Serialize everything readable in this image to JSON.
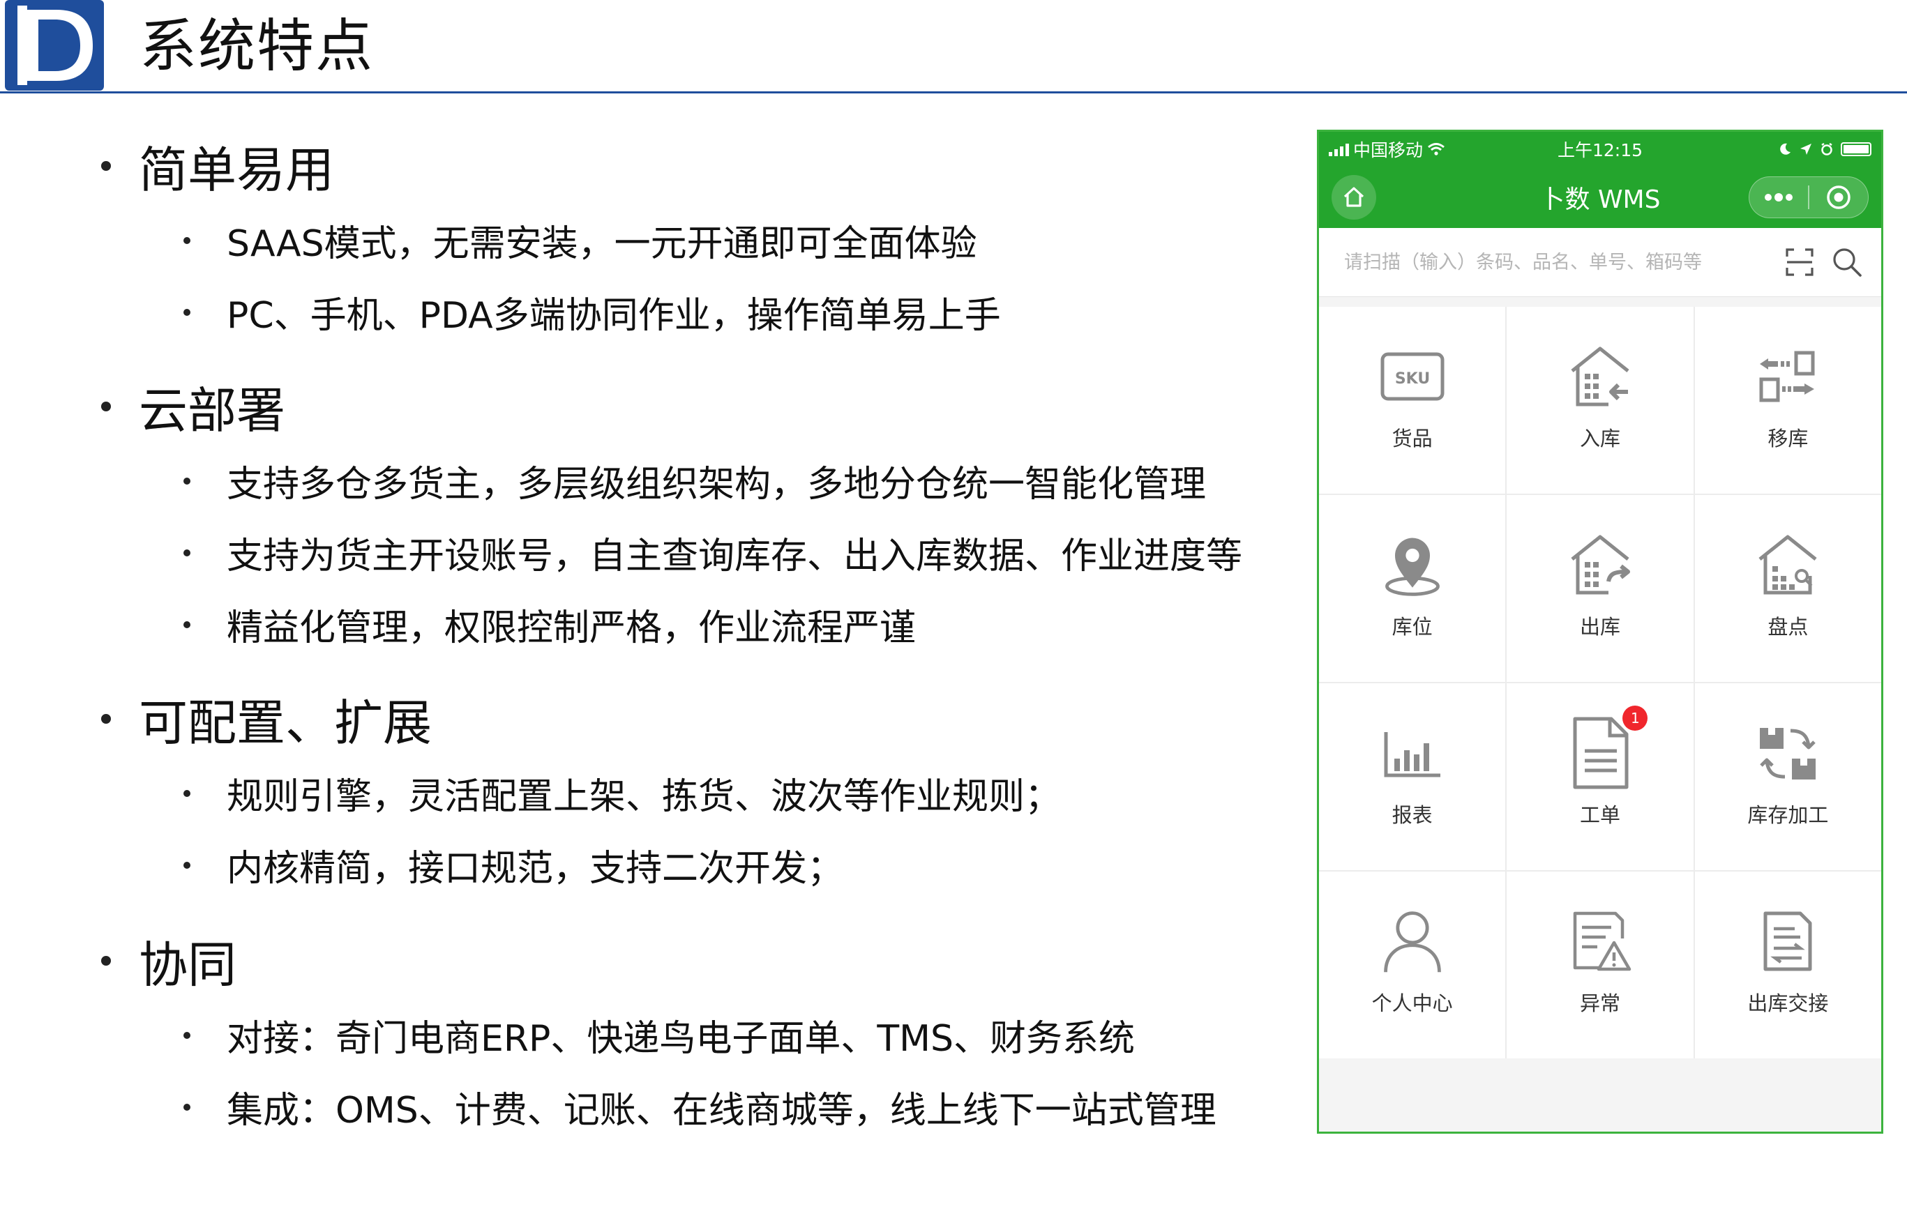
{
  "header": {
    "title": "系统特点"
  },
  "sections": [
    {
      "title": "简单易用",
      "items": [
        "SAAS模式，无需安装，一元开通即可全面体验",
        "PC、手机、PDA多端协同作业，操作简单易上手"
      ]
    },
    {
      "title": "云部署",
      "items": [
        "支持多仓多货主，多层级组织架构，多地分仓统一智能化管理",
        "支持为货主开设账号，自主查询库存、出入库数据、作业进度等",
        "精益化管理，权限控制严格，作业流程严谨"
      ]
    },
    {
      "title": "可配置、扩展",
      "items": [
        "规则引擎，灵活配置上架、拣货、波次等作业规则；",
        "内核精简，接口规范，支持二次开发；"
      ]
    },
    {
      "title": "协同",
      "items": [
        "对接：奇门电商ERP、快递鸟电子面单、TMS、财务系统",
        "集成：OMS、计费、记账、在线商城等，线上线下一站式管理"
      ]
    }
  ],
  "phone": {
    "status": {
      "carrier": "中国移动",
      "time": "上午12:15"
    },
    "nav": {
      "title": "卜数 WMS"
    },
    "search": {
      "placeholder": "请扫描（输入）条码、品名、单号、箱码等"
    },
    "accent_color": "#24a52d",
    "tiles": [
      {
        "label": "货品",
        "icon": "sku-box-icon",
        "sku_text": "SKU"
      },
      {
        "label": "入库",
        "icon": "inbound-warehouse-icon"
      },
      {
        "label": "移库",
        "icon": "transfer-arrows-icon"
      },
      {
        "label": "库位",
        "icon": "location-pin-icon"
      },
      {
        "label": "出库",
        "icon": "outbound-warehouse-icon"
      },
      {
        "label": "盘点",
        "icon": "stocktake-warehouse-icon"
      },
      {
        "label": "报表",
        "icon": "bar-chart-icon"
      },
      {
        "label": "工单",
        "icon": "document-icon",
        "badge": "1"
      },
      {
        "label": "库存加工",
        "icon": "processing-boxes-icon"
      },
      {
        "label": "个人中心",
        "icon": "user-icon"
      },
      {
        "label": "异常",
        "icon": "warning-document-icon"
      },
      {
        "label": "出库交接",
        "icon": "handover-document-icon"
      }
    ]
  }
}
